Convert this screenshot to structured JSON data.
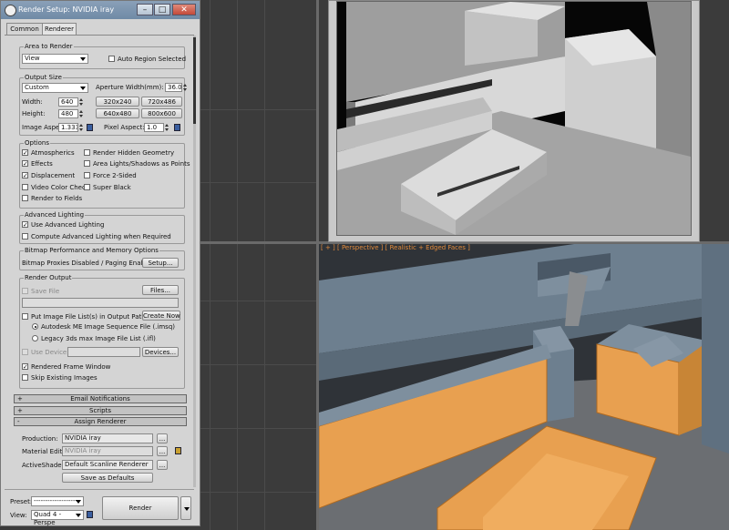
{
  "dialog": {
    "title": "Render Setup: NVIDIA iray",
    "tabs": [
      "Common",
      "Renderer"
    ],
    "area_to_render": {
      "title": "Area to Render",
      "view_value": "View",
      "auto_region_label": "Auto Region Selected"
    },
    "output_size": {
      "title": "Output Size",
      "preset_value": "Custom",
      "aperture_label": "Aperture Width(mm):",
      "aperture_value": "36.0",
      "width_label": "Width:",
      "width_value": "640",
      "height_label": "Height:",
      "height_value": "480",
      "preset_buttons": [
        "320x240",
        "720x486",
        "640x480",
        "800x600"
      ],
      "image_aspect_label": "Image Aspect:",
      "image_aspect_value": "1.333",
      "pixel_aspect_label": "Pixel Aspect:",
      "pixel_aspect_value": "1.0"
    },
    "options": {
      "title": "Options",
      "left": [
        {
          "label": "Atmospherics",
          "checked": true
        },
        {
          "label": "Effects",
          "checked": true
        },
        {
          "label": "Displacement",
          "checked": true
        },
        {
          "label": "Video Color Check",
          "checked": false
        },
        {
          "label": "Render to Fields",
          "checked": false
        }
      ],
      "right": [
        {
          "label": "Render Hidden Geometry",
          "checked": false
        },
        {
          "label": "Area Lights/Shadows as Points",
          "checked": false
        },
        {
          "label": "Force 2-Sided",
          "checked": false
        },
        {
          "label": "Super Black",
          "checked": false
        }
      ]
    },
    "advanced_lighting": {
      "title": "Advanced Lighting",
      "use_label": "Use Advanced Lighting",
      "compute_label": "Compute Advanced Lighting when Required"
    },
    "bitmap": {
      "title": "Bitmap Performance and Memory Options",
      "status": "Bitmap Proxies Disabled / Paging Enabled",
      "setup_button": "Setup..."
    },
    "render_output": {
      "title": "Render Output",
      "save_file_label": "Save File",
      "files_button": "Files...",
      "put_image_label": "Put Image File List(s) in Output Path(s)",
      "create_now_button": "Create Now",
      "autodesk_label": "Autodesk ME Image Sequence File (.imsq)",
      "legacy_label": "Legacy 3ds max Image File List (.ifl)",
      "use_device_label": "Use Device",
      "devices_button": "Devices...",
      "rendered_frame_label": "Rendered Frame Window",
      "skip_existing_label": "Skip Existing Images"
    },
    "rollouts": [
      {
        "sign": "+",
        "label": "Email Notifications"
      },
      {
        "sign": "+",
        "label": "Scripts"
      },
      {
        "sign": "-",
        "label": "Assign Renderer"
      }
    ],
    "assign_renderer": {
      "production_label": "Production:",
      "production_value": "NVIDIA iray",
      "material_label": "Material Editor:",
      "material_value": "NVIDIA iray",
      "activeshade_label": "ActiveShade:",
      "activeshade_value": "Default Scanline Renderer",
      "ellipsis": "...",
      "save_defaults_button": "Save as Defaults"
    },
    "bottom": {
      "preset_label": "Preset:",
      "preset_value": "--------------------",
      "view_label": "View:",
      "view_value": "Quad 4 - Perspe",
      "render_button": "Render"
    }
  },
  "viewport": {
    "label": "[ + ] [ Perspective ] [ Realistic + Edged Faces ]"
  },
  "colors": {
    "accent_orange": "#e8a050",
    "cabinet_blue": "#6d7f8f",
    "titlebar": "#7a93ad"
  }
}
